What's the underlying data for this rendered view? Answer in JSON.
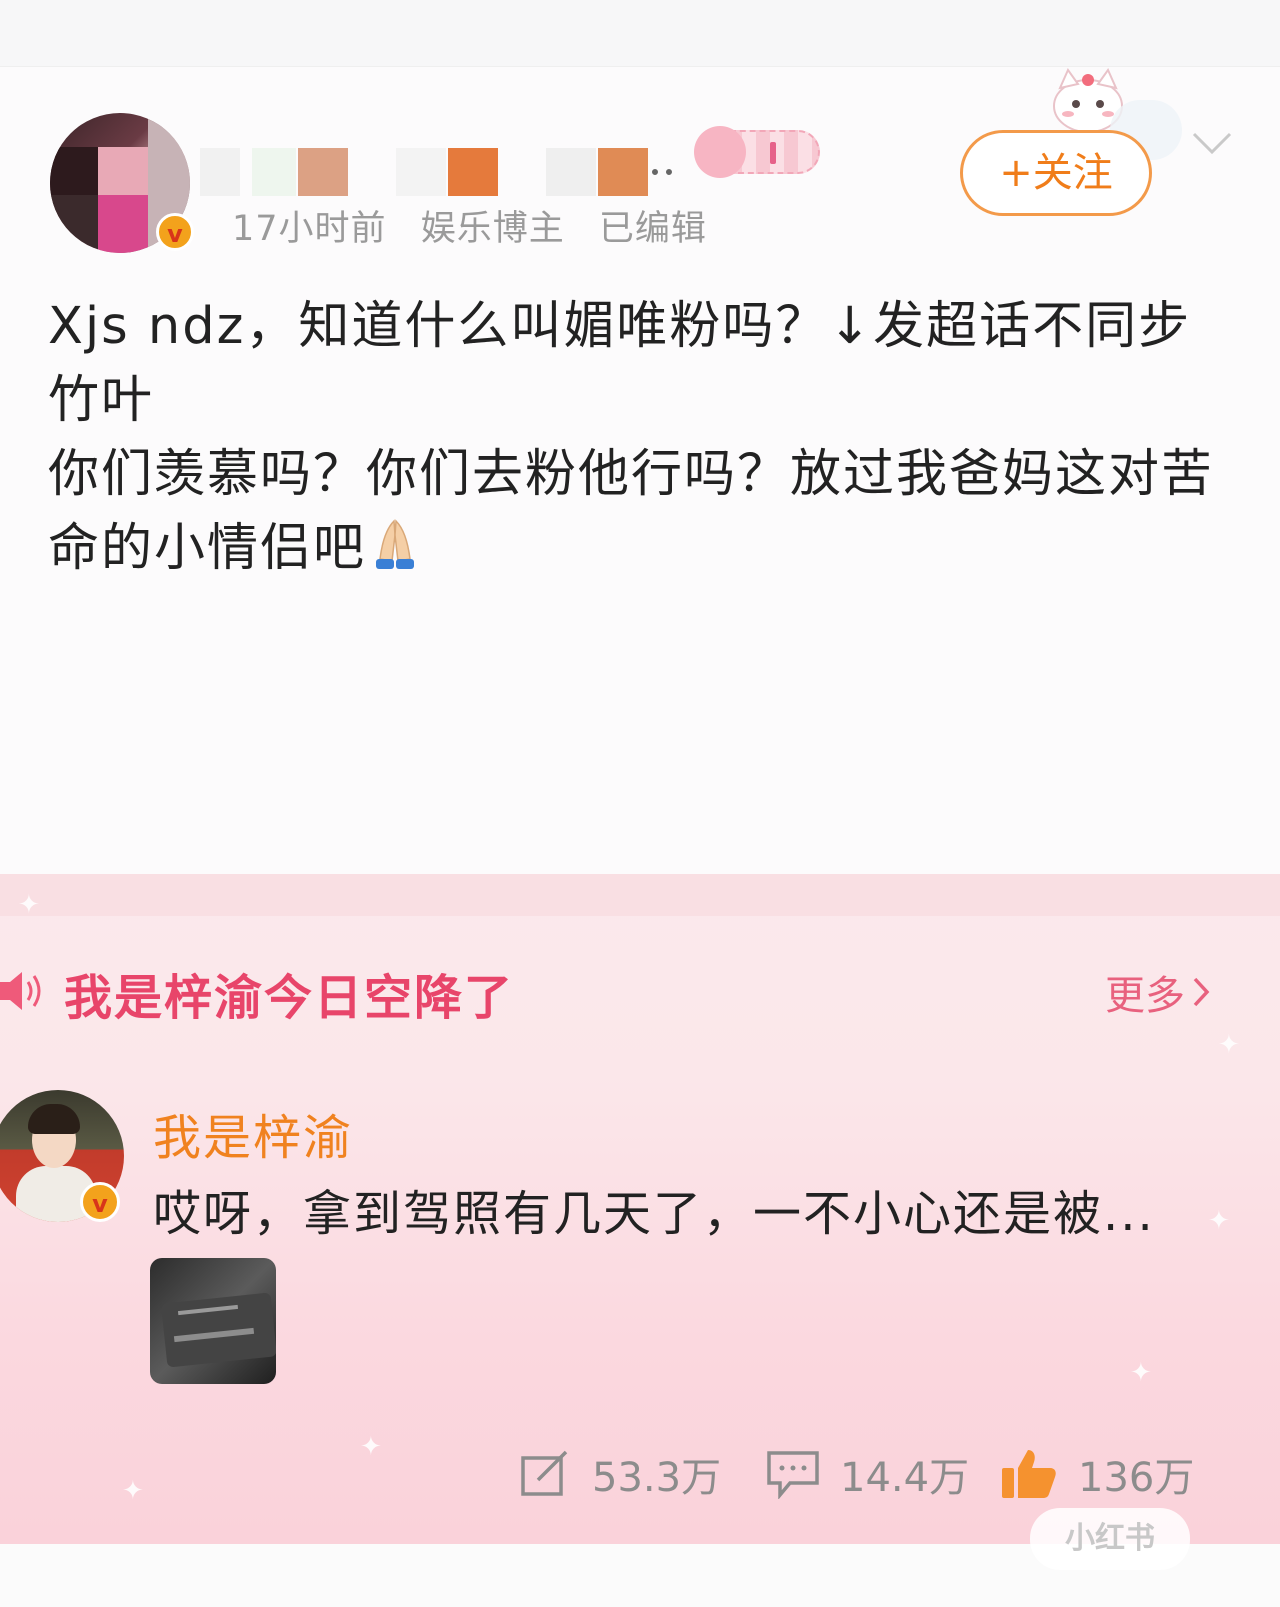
{
  "post": {
    "meta": {
      "time": "17小时前",
      "role": "娱乐博主",
      "edited": "已编辑"
    },
    "follow_label": "+关注",
    "lines": [
      "Xjs ndz，知道什么叫媚唯粉吗？↓发超话不同步竹叶",
      "你们羡慕吗？你们去粉他行吗？放过我爸妈这对苦命的小情侣吧"
    ]
  },
  "card": {
    "topic": "我是梓渝今日空降了",
    "more_label": "更多",
    "user_name": "我是梓渝",
    "message": "哎呀，拿到驾照有几天了，一不小心还是被..."
  },
  "stats": {
    "reposts": "53.3万",
    "comments": "14.4万",
    "likes": "136万"
  },
  "watermark": "小红书",
  "colors": {
    "accent_orange": "#f07d1a",
    "topic_pink": "#e8456a",
    "verified": "#f3a21c"
  },
  "icons": [
    "v-badge-icon",
    "chevron-down-icon",
    "speaker-icon",
    "chevron-right-icon",
    "repost-icon",
    "comment-icon",
    "like-icon",
    "pray-emoji-icon"
  ]
}
